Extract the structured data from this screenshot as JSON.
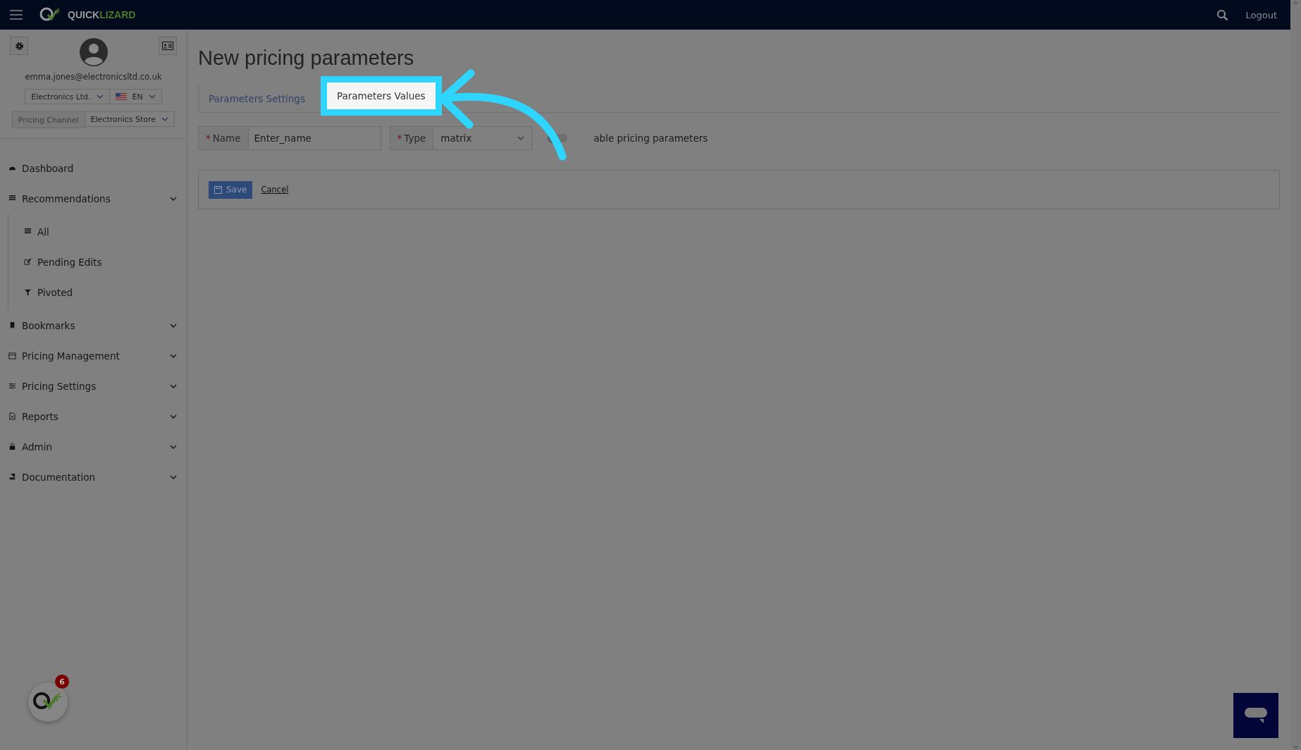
{
  "header": {
    "logo": [
      "QUICK",
      "LIZARD"
    ],
    "logout": "Logout"
  },
  "sidebar": {
    "email": "emma.jones@electronicsltd.co.uk",
    "company": "Electronics Ltd.",
    "language": "EN",
    "channel_label": "Pricing Channel",
    "channel": "Electronics Store",
    "menu": [
      {
        "label": "Dashboard",
        "collapsible": false
      },
      {
        "label": "Recommendations",
        "collapsible": true,
        "children": [
          {
            "label": "All"
          },
          {
            "label": "Pending Edits"
          },
          {
            "label": "Pivoted"
          }
        ]
      },
      {
        "label": "Bookmarks",
        "collapsible": true
      },
      {
        "label": "Pricing Management",
        "collapsible": true
      },
      {
        "label": "Pricing Settings",
        "collapsible": true
      },
      {
        "label": "Reports",
        "collapsible": true
      },
      {
        "label": "Admin",
        "collapsible": true
      },
      {
        "label": "Documentation",
        "collapsible": true
      }
    ],
    "badge_count": "6"
  },
  "page": {
    "title": "New pricing parameters",
    "tabs": [
      {
        "label": "Parameters Settings",
        "selected": true,
        "highlighted": false
      },
      {
        "label": "Parameters Values",
        "selected": false,
        "highlighted": true
      }
    ],
    "name_field": {
      "required_mark": "*",
      "label": "Name",
      "value": "Enter_name"
    },
    "type_field": {
      "required_mark": "*",
      "label": "Type",
      "value": "matrix"
    },
    "toggle": {
      "label": "able pricing parameters",
      "on": false
    },
    "buttons": {
      "save": "Save",
      "cancel": "Cancel"
    }
  }
}
